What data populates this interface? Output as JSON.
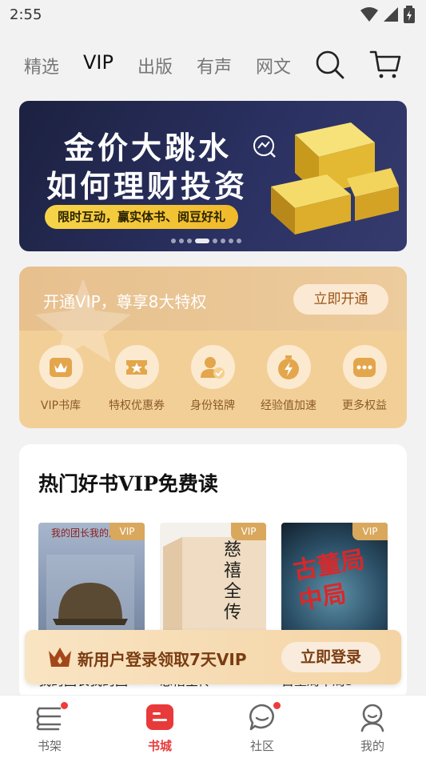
{
  "status_bar": {
    "time": "2:55",
    "icons": [
      "wifi-icon",
      "signal-icon",
      "battery-charging-icon"
    ]
  },
  "top_nav": {
    "tabs": [
      {
        "label": "精选"
      },
      {
        "label": "VIP",
        "active": true
      },
      {
        "label": "出版"
      },
      {
        "label": "有声"
      },
      {
        "label": "网文"
      }
    ],
    "icons": [
      "search-icon",
      "cart-icon"
    ]
  },
  "banner": {
    "line1": "金价大跳水",
    "line2": "如何理财投资",
    "pill": "限时互动，赢实体书、阅豆好礼",
    "slide_count": 8,
    "active_slide": 3
  },
  "vip_card": {
    "slogan": "开通VIP，尊享8大特权",
    "open_button": "立即开通",
    "perks": [
      {
        "label": "VIP书库",
        "icon": "vip-library-icon"
      },
      {
        "label": "特权优惠券",
        "icon": "coupon-icon"
      },
      {
        "label": "身份铭牌",
        "icon": "badge-icon"
      },
      {
        "label": "经验值加速",
        "icon": "exp-boost-icon"
      },
      {
        "label": "更多权益",
        "icon": "more-icon"
      }
    ]
  },
  "books_section": {
    "title": "热门好书VIP免费读",
    "vip_tag": "VIP",
    "books": [
      {
        "name": "我的团长我的团",
        "cover_title": "我的团长我的团",
        "cover_color": "#8fa0b8"
      },
      {
        "name": "慈禧全传",
        "cover_title": "慈禧全传",
        "cover_color": "#f3e6d3"
      },
      {
        "name": "古董局中局5",
        "cover_title": "古董局中局",
        "cover_color": "#2f5a73"
      }
    ]
  },
  "login_banner": {
    "text": "新用户登录领取7天VIP",
    "button": "立即登录"
  },
  "bottom_bar": {
    "tabs": [
      {
        "label": "书架",
        "icon": "bookshelf-icon",
        "badge": true
      },
      {
        "label": "书城",
        "icon": "bookstore-icon",
        "active": true
      },
      {
        "label": "社区",
        "icon": "community-icon",
        "badge": true
      },
      {
        "label": "我的",
        "icon": "profile-icon"
      }
    ]
  },
  "colors": {
    "accent_red": "#e83a3a",
    "vip_gold": "#d9a85d",
    "banner_navy": "#1c2140"
  }
}
